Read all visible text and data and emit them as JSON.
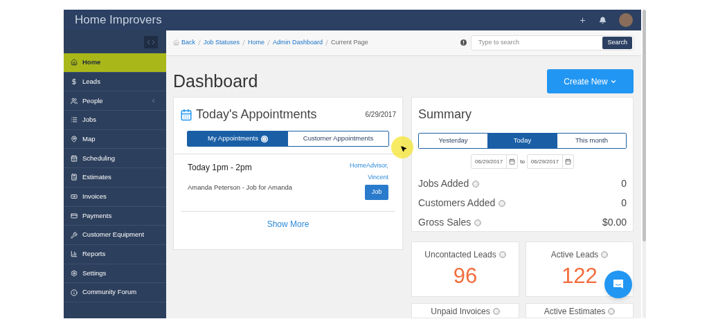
{
  "app": {
    "title": "Home Improvers"
  },
  "header_actions": [
    {
      "kind": "plus"
    },
    {
      "kind": "bell"
    },
    {
      "kind": "avatar"
    }
  ],
  "sidebar": {
    "items": [
      {
        "label": "Home",
        "selected": true,
        "has_submenu": false
      },
      {
        "label": "Leads",
        "selected": false,
        "has_submenu": false
      },
      {
        "label": "People",
        "selected": false,
        "has_submenu": true
      },
      {
        "label": "Jobs",
        "selected": false,
        "has_submenu": false
      },
      {
        "label": "Map",
        "selected": false,
        "has_submenu": false
      },
      {
        "label": "Scheduling",
        "selected": false,
        "has_submenu": false
      },
      {
        "label": "Estimates",
        "selected": false,
        "has_submenu": false
      },
      {
        "label": "Invoices",
        "selected": false,
        "has_submenu": false
      },
      {
        "label": "Payments",
        "selected": false,
        "has_submenu": false
      },
      {
        "label": "Customer Equipment",
        "selected": false,
        "has_submenu": false
      },
      {
        "label": "Reports",
        "selected": false,
        "has_submenu": false
      },
      {
        "label": "Settings",
        "selected": false,
        "has_submenu": false
      },
      {
        "label": "Community Forum",
        "selected": false,
        "has_submenu": false
      }
    ]
  },
  "breadcrumbs": [
    {
      "label": "Back",
      "link": true
    },
    {
      "label": "Job Statuses",
      "link": true
    },
    {
      "label": "Home",
      "link": true
    },
    {
      "label": "Admin Dashboard",
      "link": true
    },
    {
      "label": "Current Page",
      "link": false
    }
  ],
  "search": {
    "placeholder": "Type to search",
    "button": "Search"
  },
  "page_title": "Dashboard",
  "create_button": "Create New",
  "appointments": {
    "title": "Today's Appointments",
    "date": "6/29/2017",
    "tabs": [
      {
        "label": "My Appointments",
        "selected": true,
        "info": true
      },
      {
        "label": "Customer Appointments",
        "selected": false,
        "info": false
      }
    ],
    "items": [
      {
        "time": "Today 1pm - 2pm",
        "description": "Amanda Peterson - Job for Amanda",
        "source": "HomeAdvisor,",
        "person": "Vincent",
        "tag": "Job"
      }
    ],
    "show_more": "Show More"
  },
  "summary": {
    "title": "Summary",
    "tabs": [
      {
        "label": "Yesterday",
        "selected": false
      },
      {
        "label": "Today",
        "selected": true
      },
      {
        "label": "This month",
        "selected": false
      }
    ],
    "from": "06/29/2017",
    "to_label": "to",
    "to": "06/29/2017",
    "metrics": [
      {
        "label": "Jobs Added",
        "value": "0"
      },
      {
        "label": "Customers Added",
        "value": "0"
      },
      {
        "label": "Gross Sales",
        "value": "$0.00"
      }
    ]
  },
  "stat_cards": [
    {
      "label": "Uncontacted Leads",
      "value": "96"
    },
    {
      "label": "Active Leads",
      "value": "122"
    },
    {
      "label": "Unpaid Invoices"
    },
    {
      "label": "Active Estimates"
    }
  ]
}
